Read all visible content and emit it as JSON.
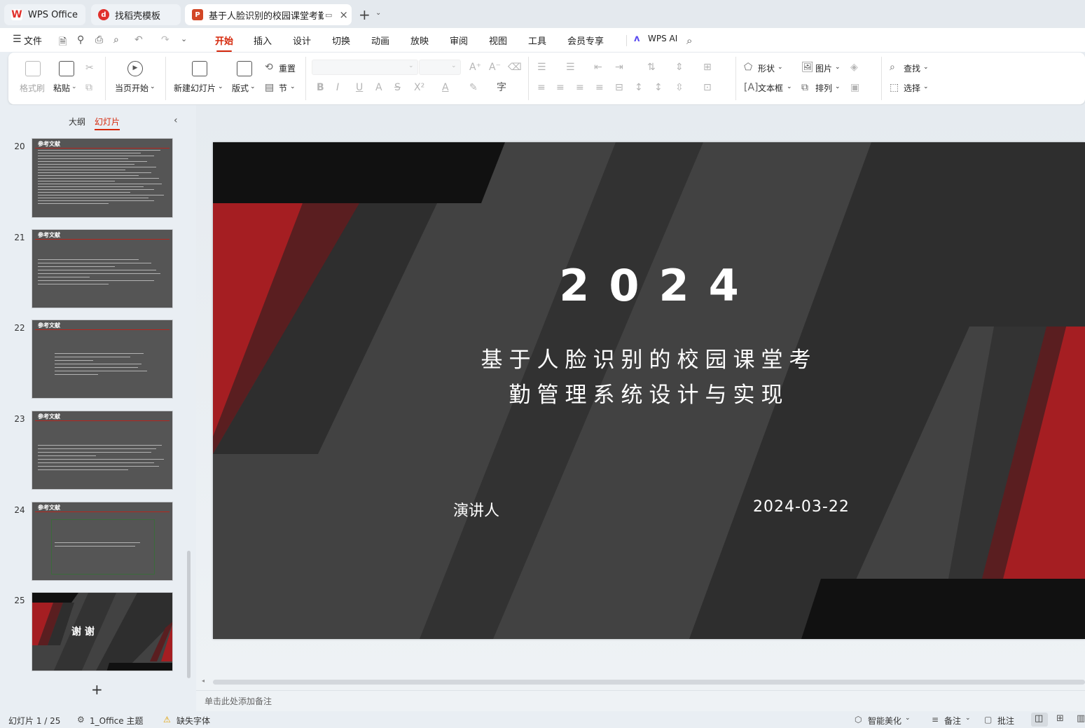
{
  "tabs": [
    {
      "label": "WPS Office",
      "icon": "wps-logo-icon",
      "active": false
    },
    {
      "label": "找稻壳模板",
      "icon": "docer-icon",
      "active": false
    },
    {
      "label": "基于人脸识别的校园课堂考勤管",
      "icon": "presentation-file-icon",
      "active": true
    }
  ],
  "menu": {
    "file": "文件",
    "items": [
      "开始",
      "插入",
      "设计",
      "切换",
      "动画",
      "放映",
      "审阅",
      "视图",
      "工具",
      "会员专享"
    ],
    "active": "开始",
    "wps_ai": "WPS AI"
  },
  "ribbon": {
    "format_painter": "格式刷",
    "paste": "粘贴",
    "start_from_current": "当页开始",
    "new_slide": "新建幻灯片",
    "layout": "版式",
    "reset": "重置",
    "section": "节",
    "shape": "形状",
    "picture": "图片",
    "textbox": "文本框",
    "arrange": "排列",
    "find": "查找",
    "select": "选择"
  },
  "sidebar": {
    "tab_outline": "大纲",
    "tab_slides": "幻灯片",
    "active_tab": "幻灯片",
    "thumbnails": [
      {
        "num": "20",
        "title": "参考文献"
      },
      {
        "num": "21",
        "title": "参考文献"
      },
      {
        "num": "22",
        "title": "参考文献"
      },
      {
        "num": "23",
        "title": "参考文献"
      },
      {
        "num": "24",
        "title": "参考文献"
      },
      {
        "num": "25",
        "title": "谢 谢"
      }
    ],
    "add": "+"
  },
  "slide": {
    "year": "2024",
    "title_line1": "基于人脸识别的校园课堂考",
    "title_line2": "勤管理系统设计与实现",
    "presenter": "演讲人",
    "date": "2024-03-22",
    "colors": {
      "bg": "#424242",
      "red": "#a51e22",
      "dark_red": "#5a1e20",
      "black": "#111111",
      "dark": "#2e2e2e"
    }
  },
  "notes_placeholder": "单击此处添加备注",
  "status": {
    "slide_counter": "幻灯片 1 / 25",
    "theme": "1_Office 主题",
    "missing_font": "缺失字体",
    "smart_beautify": "智能美化",
    "notes": "备注",
    "comments": "批注"
  }
}
